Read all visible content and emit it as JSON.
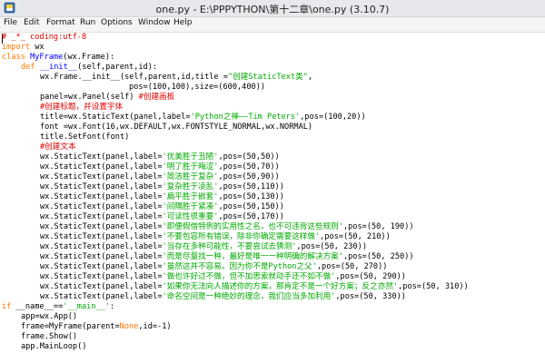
{
  "window": {
    "title": "one.py - E:\\PPPYTHON\\第十二章\\one.py (3.10.7)"
  },
  "menu": [
    "File",
    "Edit",
    "Format",
    "Run",
    "Options",
    "Window",
    "Help"
  ],
  "code": {
    "l1": "# _*_ coding:utf-8",
    "l2_kw": "import",
    "l2_rest": " wx",
    "l3_kw": "class",
    "l3_name": "MyFrame",
    "l3_rest": "(wx.Frame):",
    "l4_kw": "def",
    "l4_name": "__init__",
    "l4_rest": "(self,parent,id):",
    "l5_a": "wx.Frame.__init__(self,parent,id,title =",
    "l5_str": "\"创建StaticText类\"",
    "l5_b": ",",
    "l6": "pos=(100,100),size=(600,400))",
    "l7_a": "panel=wx.Panel(self)",
    "l7_cmt": "#创建画板",
    "l8_cmt": "#创建标题，并设置字体",
    "l9_a": "title=wx.StaticText(panel,label=",
    "l9_str": "'Python之禅——Tim Peters'",
    "l9_b": ",pos=(100,20))",
    "l10": "font =wx.Font(16,wx.DEFAULT,wx.FONTSTYLE_NORMAL,wx.NORMAL)",
    "l11": "title.SetFont(font)",
    "l12_cmt": "#创建文本",
    "st_prefix": "wx.StaticText(panel,label=",
    "st_labels": [
      "'优美胜于丑陋'",
      "'明了胜于晦涩'",
      "'简洁胜于复杂'",
      "'复杂胜于凌乱'",
      "'扁平胜于嵌套'",
      "'间隔胜于紧凑'",
      "'可读性很重要'",
      "'即便假借特例的实用性之名，也不可违背这些规则'",
      "'不要包容所有错误，除非你确定需要这样做'",
      "'当存在多种可能性，不要尝试去猜测'",
      "'而是尽量找一种，最好是唯一一种明确的解决方案'",
      "'虽然这并不容易，因为你不是Python之父'",
      "'做也许好过不做，但不加思索就动手还不如不做'",
      "'如果你无法向人描述你的方案，那肯定不是一个好方案；反之亦然'",
      "'命名空间是一种绝妙的理念，我们应当多加利用'"
    ],
    "st_suffixes": [
      ",pos=(50,50))",
      ",pos=(50,70))",
      ",pos=(50,90))",
      ",pos=(50,110))",
      ",pos=(50,130))",
      ",pos=(50,150))",
      ",pos=(50,170))",
      ",pos=(50, 190))",
      ",pos=(50, 210))",
      ",pos=(50, 230))",
      ",pos=(50, 250))",
      ",pos=(50, 270))",
      ",pos=(50, 290))",
      ",pos=(50, 310))",
      ",pos=(50, 330))"
    ],
    "l28_kw": "if",
    "l28_a": " __name__==",
    "l28_str": "'__main__'",
    "l28_b": ":",
    "l29": "app=wx.App()",
    "l30_a": "frame=MyFrame(parent=",
    "l30_kw": "None",
    "l30_b": ",id=-1)",
    "l31": "frame.Show()",
    "l32": "app.MainLoop()"
  },
  "colors": {
    "keyword": "#ff7700",
    "string": "#00aa00",
    "comment": "#dd0000",
    "definition": "#0000ff"
  }
}
